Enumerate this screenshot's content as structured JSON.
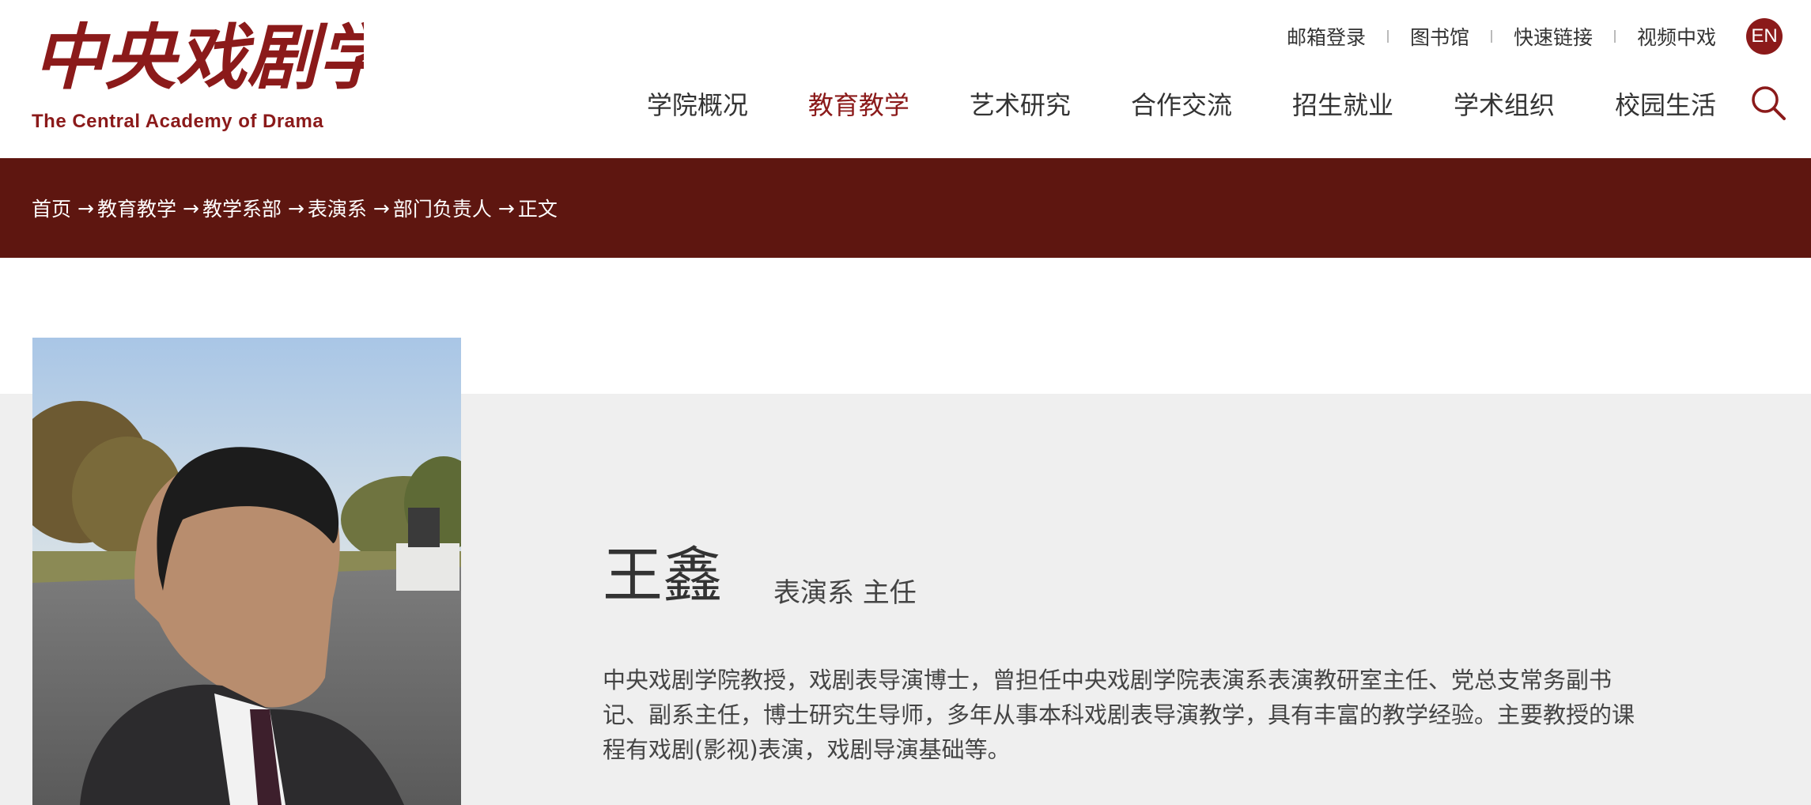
{
  "logo": {
    "cn_text": "中央戏剧学院",
    "en_text": "The Central Academy of Drama"
  },
  "toplinks": [
    "邮箱登录",
    "图书馆",
    "快速链接",
    "视频中戏"
  ],
  "lang_button": "EN",
  "nav": [
    {
      "label": "学院概况",
      "active": false
    },
    {
      "label": "教育教学",
      "active": true
    },
    {
      "label": "艺术研究",
      "active": false
    },
    {
      "label": "合作交流",
      "active": false
    },
    {
      "label": "招生就业",
      "active": false
    },
    {
      "label": "学术组织",
      "active": false
    },
    {
      "label": "校园生活",
      "active": false
    }
  ],
  "breadcrumb": [
    "首页",
    "教育教学",
    "教学系部",
    "表演系",
    "部门负责人",
    "正文"
  ],
  "profile": {
    "name": "王鑫",
    "role": "表演系 主任",
    "bio": "中央戏剧学院教授，戏剧表导演博士，曾担任中央戏剧学院表演系表演教研室主任、党总支常务副书记、副系主任，博士研究生导师，多年从事本科戏剧表导演教学，具有丰富的教学经验。主要教授的课程有戏剧(影视)表演，戏剧导演基础等。"
  },
  "colors": {
    "brand": "#8b1a1a",
    "breadcrumb_bg": "#5e1610",
    "content_bg": "#efefef"
  },
  "icons": {
    "search": "search-icon",
    "breadcrumb_separator": "arrow-right-icon"
  }
}
